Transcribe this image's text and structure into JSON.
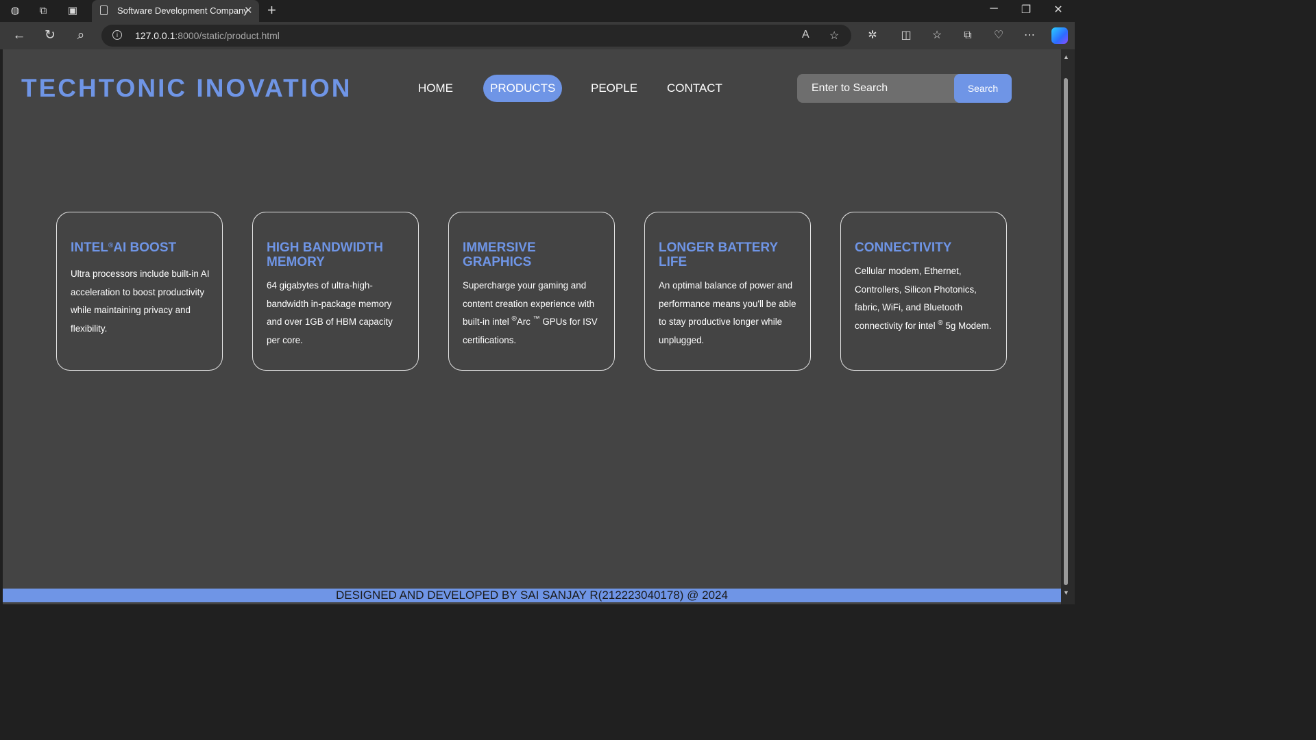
{
  "browser": {
    "tab_title": "Software Development Company",
    "tab_close": "✕",
    "new_tab": "+",
    "url_host": "127.0.0.1",
    "url_rest": ":8000/static/product.html"
  },
  "site": {
    "brand": "TECHTONIC INOVATION",
    "nav": [
      "HOME",
      "PRODUCTS",
      "PEOPLE",
      "CONTACT"
    ],
    "active_nav": "PRODUCTS",
    "search_placeholder": "Enter to Search",
    "search_button": "Search"
  },
  "cards": [
    {
      "title_pre": "INTEL",
      "title_sup": "®",
      "title_post": "AI BOOST",
      "text": "Ultra processors include built-in AI acceleration to boost productivity while maintaining privacy and flexibility."
    },
    {
      "title": "HIGH BANDWIDTH MEMORY",
      "text": "64 gigabytes of ultra-high-bandwidth in-package memory and over 1GB of HBM capacity per core."
    },
    {
      "title": "IMMERSIVE GRAPHICS",
      "text_1": "Supercharge your gaming and content creation experience with built-in intel ",
      "sup_1": "®",
      "text_2": "Arc ",
      "sup_2": "™",
      "text_3": " GPUs for ISV certifications."
    },
    {
      "title": "LONGER BATTERY LIFE",
      "text": "An optimal balance of power and performance means you'll be able to stay productive longer while unplugged."
    },
    {
      "title": "CONNECTIVITY",
      "text_1": "Cellular modem, Ethernet, Controllers, Silicon Photonics, fabric, WiFi, and Bluetooth connectivity for intel ",
      "sup_1": "®",
      "text_2": " 5g Modem."
    }
  ],
  "footer": "DESIGNED AND DEVELOPED BY SAI SANJAY R(212223040178) @ 2024",
  "icons": {
    "profile": "profile-icon",
    "workspaces": "workspaces-icon",
    "tab_actions": "tab-actions-icon",
    "back": "back-arrow-icon",
    "refresh": "refresh-icon",
    "search": "search-icon",
    "site_info": "site-info-icon",
    "read_aloud": "read-aloud-icon",
    "favorite": "star-icon",
    "extensions": "extensions-icon",
    "split_screen": "split-screen-icon",
    "favorites": "favorites-icon",
    "collections": "collections-icon",
    "browser_essentials": "heart-pulse-icon",
    "more": "more-icon",
    "copilot": "copilot-icon"
  },
  "colors": {
    "accent": "#6f95e6",
    "page_bg": "#444444",
    "card_border": "#e6e6e6"
  }
}
